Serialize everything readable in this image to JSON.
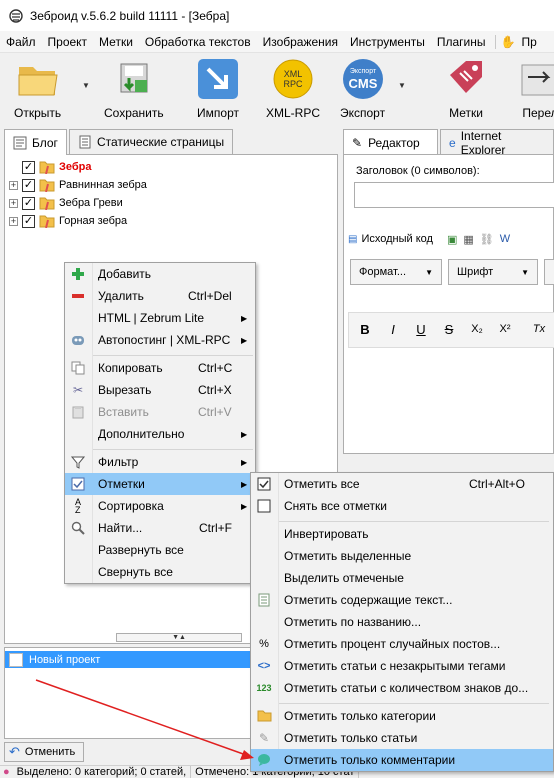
{
  "window": {
    "title": "Зеброид v.5.6.2 build 11111 - [Зебра]"
  },
  "menubar": [
    "Файл",
    "Проект",
    "Метки",
    "Обработка текстов",
    "Изображения",
    "Инструменты",
    "Плагины",
    "Пр"
  ],
  "toolbar": {
    "open": "Открыть",
    "save": "Сохранить",
    "import": "Импорт",
    "xmlrpc": "XML-RPC",
    "export": "Экспорт",
    "tags": "Метки",
    "transfer": "Перел",
    "xmlrpc_icon_text": "XML\nRPC",
    "export_icon_text": "Экспорт",
    "cms_text": "CMS"
  },
  "left_tabs": {
    "blog": "Блог",
    "static": "Статические страницы"
  },
  "tree": [
    {
      "label": "Зебра",
      "red": true,
      "expander": false
    },
    {
      "label": "Равнинная зебра",
      "red": false,
      "expander": true
    },
    {
      "label": "Зебра Греви",
      "red": false,
      "expander": true
    },
    {
      "label": "Горная зебра",
      "red": false,
      "expander": true
    }
  ],
  "project": {
    "name": "Новый проект"
  },
  "cancel_button": "Отменить",
  "statusbar": {
    "selected": "Выделено: 0 категорий; 0 статей,",
    "marked": "Отмечено: 1 категорий; 10 стат"
  },
  "right_tabs": {
    "editor": "Редактор",
    "ie": "Internet Explorer"
  },
  "editor": {
    "heading_label": "Заголовок (0 символов):",
    "source_code": "Исходный код",
    "format": "Формат...",
    "font": "Шрифт",
    "styles": [
      "B",
      "I",
      "U",
      "S",
      "X₂",
      "X²",
      "Tx"
    ]
  },
  "context_menu": [
    {
      "label": "Добавить",
      "shortcut": "",
      "icon": "add-icon",
      "sub": false,
      "disabled": false
    },
    {
      "label": "Удалить",
      "shortcut": "Ctrl+Del",
      "icon": "delete-icon",
      "sub": false,
      "disabled": false
    },
    {
      "label": "HTML | Zebrum Lite",
      "shortcut": "",
      "icon": "",
      "sub": true,
      "disabled": false
    },
    {
      "label": "Автопостинг | XML-RPC",
      "shortcut": "",
      "icon": "robot-icon",
      "sub": true,
      "disabled": false
    },
    {
      "label": "Копировать",
      "shortcut": "Ctrl+C",
      "icon": "copy-icon",
      "sub": false,
      "disabled": false
    },
    {
      "label": "Вырезать",
      "shortcut": "Ctrl+X",
      "icon": "scissors-icon",
      "sub": false,
      "disabled": false
    },
    {
      "label": "Вставить",
      "shortcut": "Ctrl+V",
      "icon": "paste-icon",
      "sub": false,
      "disabled": true
    },
    {
      "label": "Дополнительно",
      "shortcut": "",
      "icon": "",
      "sub": true,
      "disabled": false
    },
    {
      "label": "Фильтр",
      "shortcut": "",
      "icon": "filter-icon",
      "sub": true,
      "disabled": false
    },
    {
      "label": "Отметки",
      "shortcut": "",
      "icon": "checklist-icon",
      "sub": true,
      "disabled": false
    },
    {
      "label": "Сортировка",
      "shortcut": "",
      "icon": "sort-icon",
      "sub": true,
      "disabled": false
    },
    {
      "label": "Найти...",
      "shortcut": "Ctrl+F",
      "icon": "search-icon",
      "sub": false,
      "disabled": false
    },
    {
      "label": "Развернуть все",
      "shortcut": "",
      "icon": "",
      "sub": false,
      "disabled": false
    },
    {
      "label": "Свернуть все",
      "shortcut": "",
      "icon": "",
      "sub": false,
      "disabled": false
    }
  ],
  "submenu": [
    {
      "label": "Отметить все",
      "shortcut": "Ctrl+Alt+O",
      "icon": "checked-box-icon"
    },
    {
      "label": "Снять все отметки",
      "shortcut": "",
      "icon": "empty-box-icon"
    },
    {
      "label": "Инвертировать",
      "shortcut": "",
      "icon": ""
    },
    {
      "label": "Отметить выделенные",
      "shortcut": "",
      "icon": ""
    },
    {
      "label": "Выделить отмеченые",
      "shortcut": "",
      "icon": ""
    },
    {
      "label": "Отметить содержащие текст...",
      "shortcut": "",
      "icon": "document-icon"
    },
    {
      "label": "Отметить по названию...",
      "shortcut": "",
      "icon": ""
    },
    {
      "label": "Отметить процент случайных постов...",
      "shortcut": "",
      "icon": "percent-icon"
    },
    {
      "label": "Отметить статьи с незакрытыми тегами",
      "shortcut": "",
      "icon": "code-tags-icon"
    },
    {
      "label": "Отметить статьи с количеством знаков до...",
      "shortcut": "",
      "icon": "digits-icon"
    },
    {
      "label": "Отметить только категории",
      "shortcut": "",
      "icon": "folder-icon"
    },
    {
      "label": "Отметить только статьи",
      "shortcut": "",
      "icon": "pen-icon"
    },
    {
      "label": "Отметить только комментарии",
      "shortcut": "",
      "icon": "comment-icon"
    }
  ]
}
